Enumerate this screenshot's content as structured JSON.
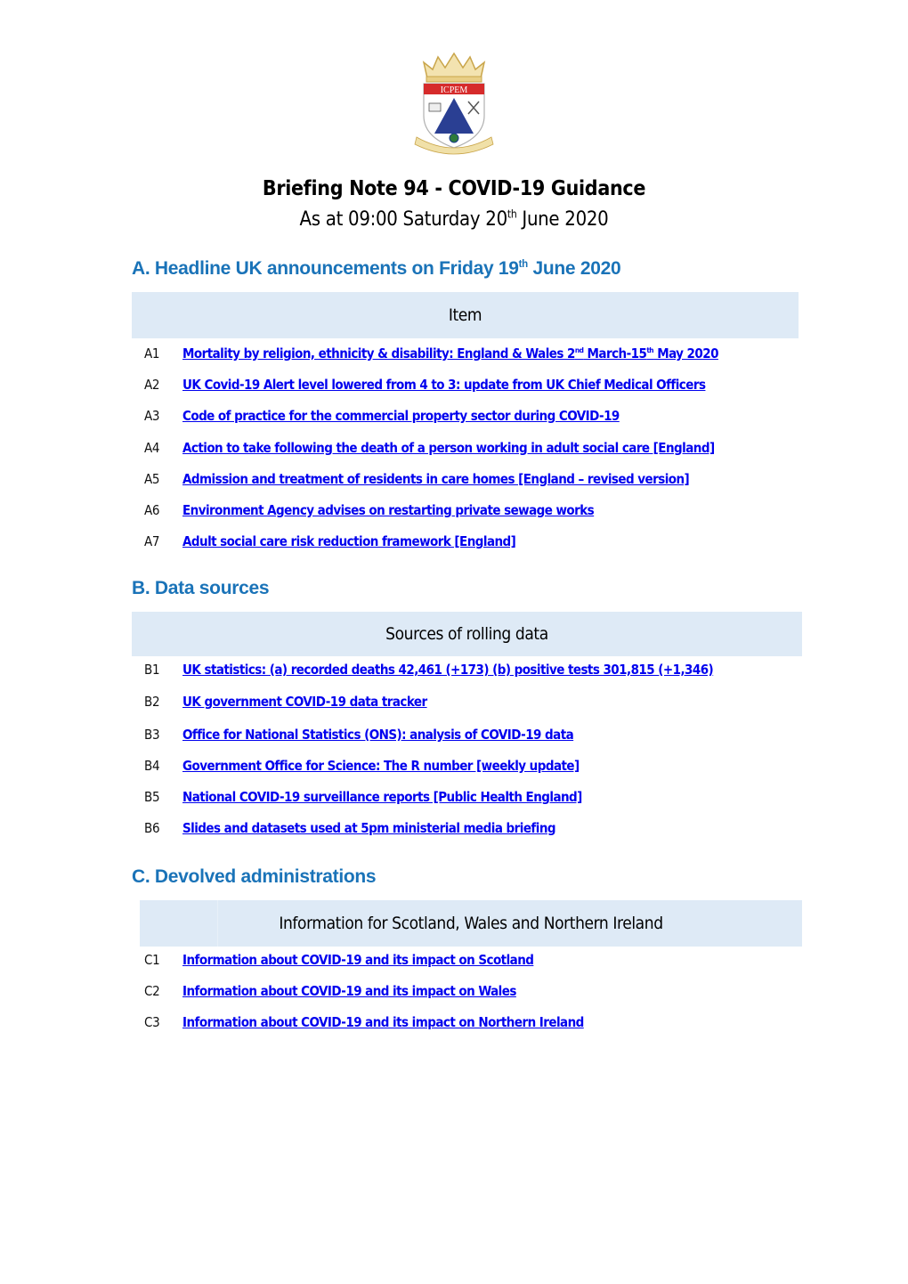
{
  "logo": {
    "text": "ICPEM",
    "colors": {
      "crown": "#d9b75a",
      "banner": "#d62b2b",
      "triangle": "#2a3f93",
      "scroll": "#e6cf8f"
    }
  },
  "header": {
    "title": "Briefing Note 94 - COVID-19 Guidance",
    "subtitle_prefix": "As at 09:00 Saturday 20",
    "subtitle_sup": "th",
    "subtitle_suffix": " June 2020"
  },
  "section_a": {
    "heading_prefix": "A. Headline UK announcements on Friday 19",
    "heading_sup": "th",
    "heading_suffix": " June 2020",
    "column_header": "Item",
    "items": [
      {
        "code": "A1",
        "parts": [
          "Mortality by religion, ethnicity & disability: England & Wales 2",
          "nd",
          " March-15",
          "th",
          " May 2020"
        ]
      },
      {
        "code": "A2",
        "label": "UK Covid-19 Alert level lowered from 4 to 3: update from UK Chief Medical Officers"
      },
      {
        "code": "A3",
        "label": "Code of practice for the commercial property sector during COVID-19"
      },
      {
        "code": "A4",
        "label": "Action to take following the death of a person working in adult social care [England]"
      },
      {
        "code": "A5",
        "label": "Admission and treatment of residents in care homes [England – revised version]"
      },
      {
        "code": "A6",
        "label": "Environment Agency advises on restarting private sewage works"
      },
      {
        "code": "A7",
        "label": "Adult social care risk reduction framework [England]"
      }
    ]
  },
  "section_b": {
    "heading": "B. Data sources",
    "column_header": "Sources of rolling data",
    "items": [
      {
        "code": "B1",
        "label": "UK statistics: (a) recorded deaths 42,461 (+173) (b) positive tests 301,815 (+1,346)"
      },
      {
        "code": "B2",
        "label": "UK government COVID-19 data tracker"
      },
      {
        "code": "B3",
        "label": "Office for National Statistics (ONS): analysis of COVID-19 data"
      },
      {
        "code": "B4",
        "label": "Government Office for Science: The R number [weekly update]"
      },
      {
        "code": "B5",
        "label": "National COVID-19 surveillance reports [Public Health England]"
      },
      {
        "code": "B6",
        "label": "Slides and datasets used at 5pm ministerial media briefing"
      }
    ]
  },
  "section_c": {
    "heading": "C. Devolved administrations",
    "column_header": "Information for Scotland, Wales and Northern Ireland",
    "items": [
      {
        "code": "C1",
        "label": "Information about COVID-19 and its impact on Scotland"
      },
      {
        "code": "C2",
        "label": "Information about COVID-19 and its impact on Wales"
      },
      {
        "code": "C3",
        "label": "Information about COVID-19 and its impact on Northern Ireland"
      }
    ]
  },
  "colors": {
    "heading_blue": "#1a73b8",
    "link_blue": "#0000ee",
    "table_header_bg": "#deeaf6"
  }
}
